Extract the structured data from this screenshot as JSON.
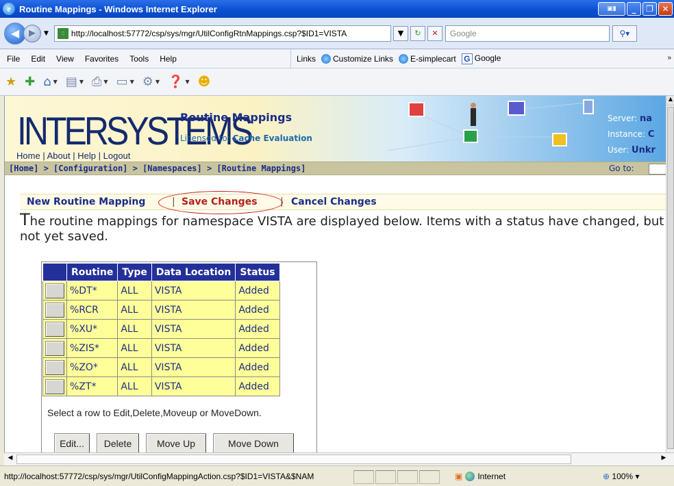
{
  "window": {
    "title": "Routine Mappings - Windows Internet Explorer"
  },
  "address_bar": {
    "url": "http://localhost:57772/csp/sys/mgr/UtilConfigRtnMappings.csp?$ID1=VISTA",
    "search_placeholder": "Google"
  },
  "menu": [
    "File",
    "Edit",
    "View",
    "Favorites",
    "Tools",
    "Help"
  ],
  "links_bar": {
    "label": "Links",
    "items": [
      "Customize Links",
      "E-simplecart",
      "Google"
    ]
  },
  "header": {
    "logo": "INTERSYSTEMS",
    "links": [
      "Home",
      "About",
      "Help",
      "Logout"
    ],
    "page_title": "Routine Mappings",
    "licensed_label": "Licensed to:",
    "licensed_value": "Cache Evaluation",
    "server_label": "Server:",
    "server_value": "na",
    "instance_label": "Instance:",
    "instance_value": "C",
    "user_label": "User:",
    "user_value": "Unkr"
  },
  "breadcrumb": {
    "text": "[Home] > [Configuration] > [Namespaces] > [Routine Mappings]",
    "goto_label": "Go to:"
  },
  "actions": {
    "new": "New Routine Mapping",
    "save": "Save Changes",
    "cancel": "Cancel Changes",
    "sep": "|"
  },
  "description": {
    "first_letter": "T",
    "rest": "he routine mappings for namespace VISTA are displayed below. Items with a status have changed, but not yet saved."
  },
  "table": {
    "columns": [
      "Routine",
      "Type",
      "Data Location",
      "Status"
    ],
    "rows": [
      [
        "%DT*",
        "ALL",
        "VISTA",
        "Added"
      ],
      [
        "%RCR",
        "ALL",
        "VISTA",
        "Added"
      ],
      [
        "%XU*",
        "ALL",
        "VISTA",
        "Added"
      ],
      [
        "%ZIS*",
        "ALL",
        "VISTA",
        "Added"
      ],
      [
        "%ZO*",
        "ALL",
        "VISTA",
        "Added"
      ],
      [
        "%ZT*",
        "ALL",
        "VISTA",
        "Added"
      ]
    ],
    "hint": "Select a row to Edit,Delete,Moveup or MoveDown.",
    "buttons": [
      "Edit...",
      "Delete",
      "Move Up",
      "Move Down"
    ]
  },
  "status_bar": {
    "url": "http://localhost:57772/csp/sys/mgr/UtilConfigMappingAction.csp?$ID1=VISTA&$NAM",
    "zone": "Internet",
    "zoom": "100%"
  }
}
